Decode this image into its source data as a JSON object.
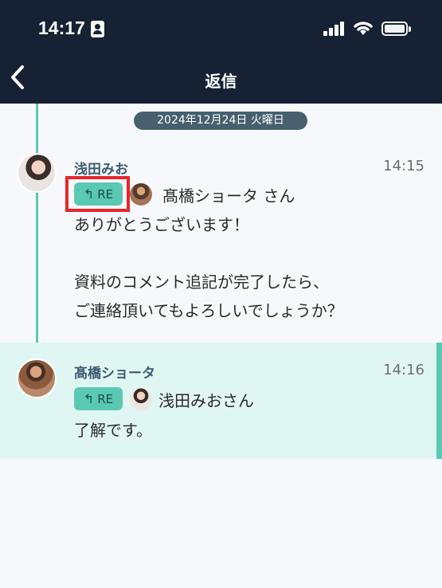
{
  "status_bar": {
    "time": "14:17"
  },
  "nav": {
    "title": "返信"
  },
  "date_divider": "2024年12月24日 火曜日",
  "messages": [
    {
      "sender": "浅田みお",
      "time": "14:15",
      "re_label": "RE",
      "reply_to": "髙橋ショータ さん",
      "text": "ありがとうございます！\n\n資料のコメント追記が完了したら、\nご連絡頂いてもよろしいでしょうか？"
    },
    {
      "sender": "髙橋ショータ",
      "time": "14:16",
      "re_label": "RE",
      "reply_to": "浅田みおさん",
      "text": "了解です。"
    }
  ],
  "colors": {
    "header_bg": "#162234",
    "accent": "#5ac9b4",
    "highlight": "#e8262a",
    "selected_row_bg": "#e0f6f2"
  }
}
